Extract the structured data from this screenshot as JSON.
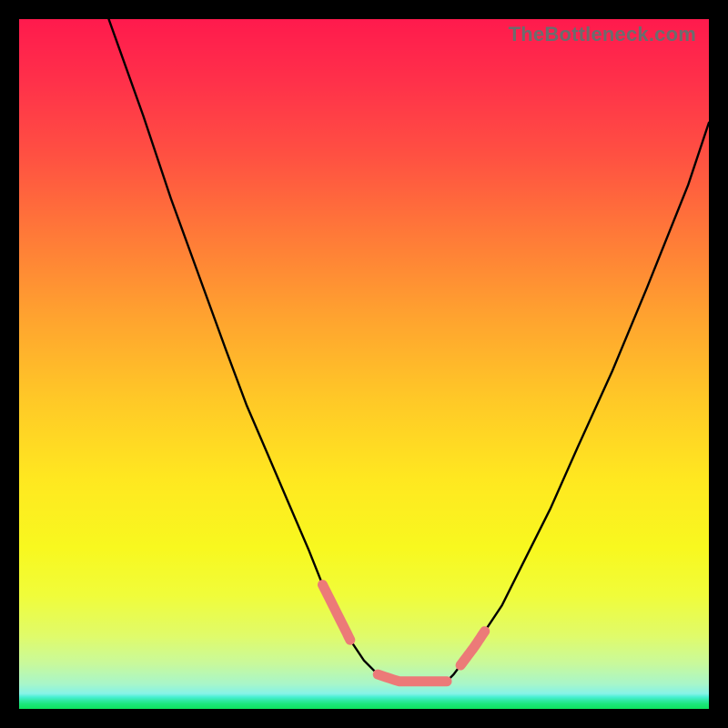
{
  "watermark": {
    "text": "TheBottleneck.com"
  },
  "colors": {
    "background": "#000000",
    "gradient_top": "#ff1a4d",
    "gradient_mid": "#ffe820",
    "gradient_bottom": "#0ee35e",
    "curve_stroke": "#000000",
    "highlight_stroke": "#ec7a78"
  },
  "chart_data": {
    "type": "line",
    "title": "",
    "xlabel": "",
    "ylabel": "",
    "xlim": [
      0,
      100
    ],
    "ylim": [
      0,
      100
    ],
    "grid": false,
    "legend": false,
    "series": [
      {
        "name": "curve",
        "x": [
          13,
          18,
          22,
          26,
          30,
          33,
          36,
          39,
          42,
          44,
          46,
          48,
          50,
          52,
          55,
          58,
          62,
          63,
          66,
          70,
          73,
          77,
          81,
          86,
          91,
          97,
          100
        ],
        "y": [
          100,
          86,
          74,
          63,
          52,
          44,
          37,
          30,
          23,
          18,
          14,
          10,
          7,
          5,
          4,
          4,
          4,
          5,
          9,
          15,
          21,
          29,
          38,
          49,
          61,
          76,
          85
        ],
        "stroke": "#000000",
        "width": 2.4
      }
    ],
    "highlights": [
      {
        "name": "left-segment",
        "x0": 44.0,
        "x1": 48.0
      },
      {
        "name": "floor-segment",
        "x0": 52.0,
        "x1": 62.0
      },
      {
        "name": "right-segment",
        "x0": 64.0,
        "x1": 67.5
      }
    ],
    "annotations": []
  }
}
